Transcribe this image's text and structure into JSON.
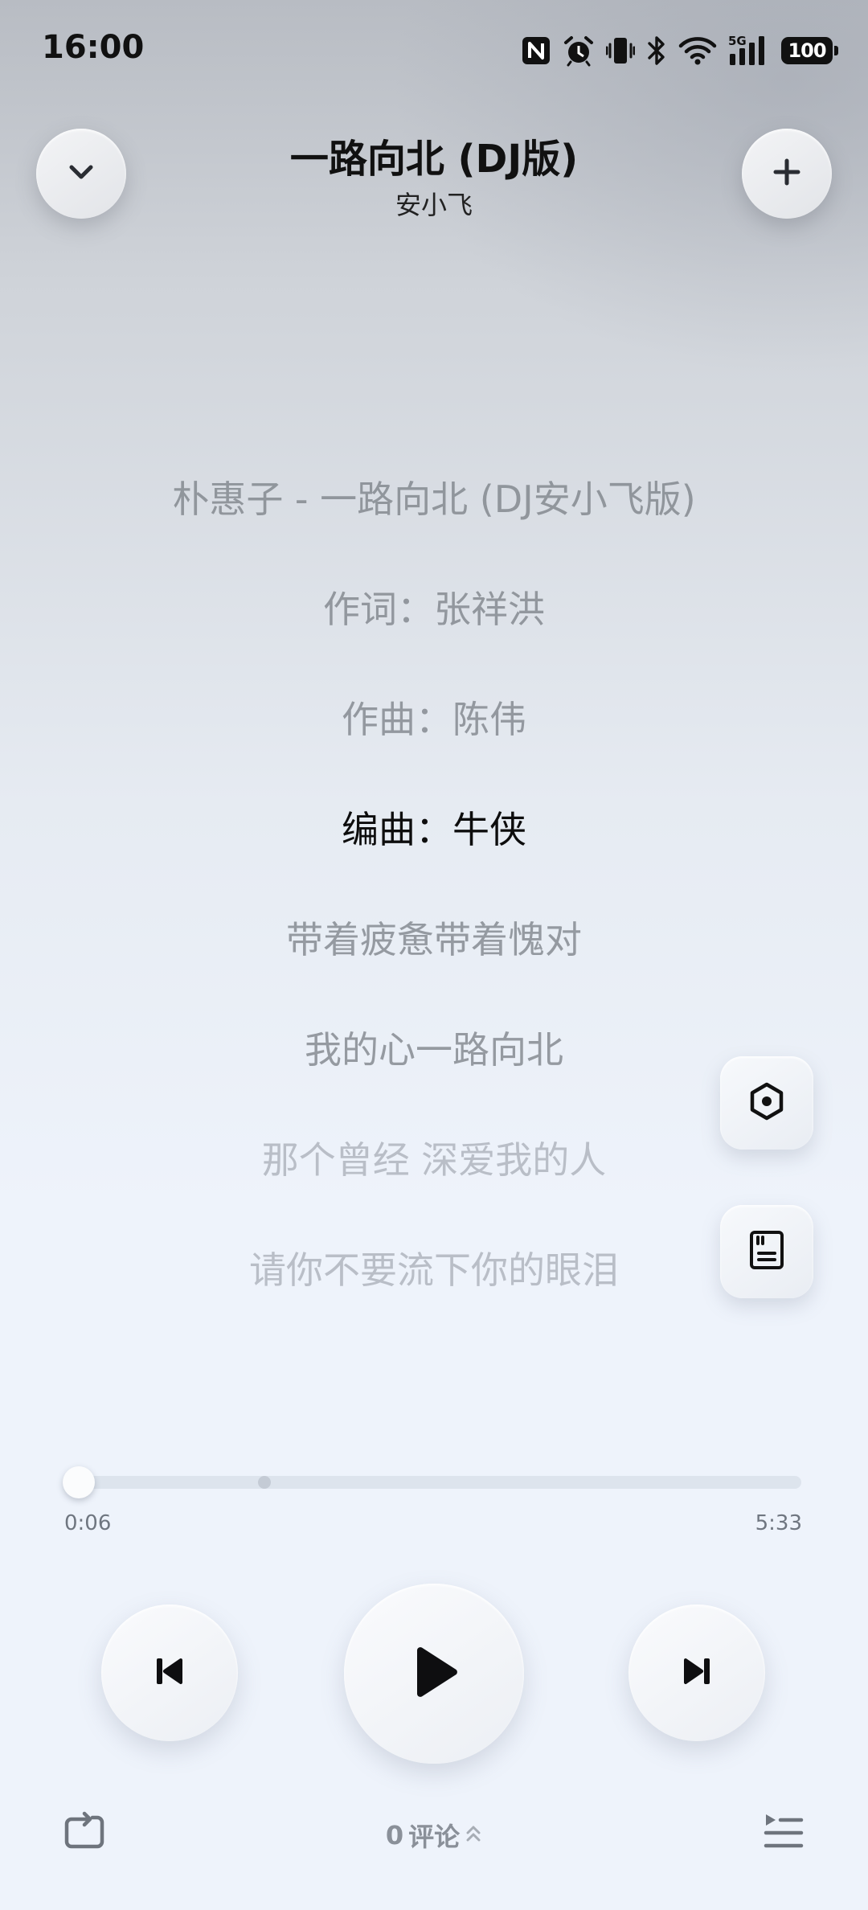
{
  "status_bar": {
    "time": "16:00",
    "icons": [
      "nfc-icon",
      "alarm-icon",
      "vibrate-icon",
      "bluetooth-icon",
      "wifi-icon",
      "signal-5g-icon"
    ],
    "network_label": "5G",
    "battery": "100"
  },
  "header": {
    "title": "一路向北 (DJ版)",
    "artist": "安小飞",
    "collapse_icon": "chevron-down-icon",
    "add_icon": "plus-icon"
  },
  "lyrics": {
    "lines": [
      "朴惠子 - 一路向北 (DJ安小飞版)",
      "作词：张祥洪",
      "作曲：陈伟",
      "编曲：牛侠",
      "带着疲惫带着愧对",
      "我的心一路向北",
      "那个曾经 深爱我的人",
      "请你不要流下你的眼泪"
    ],
    "active_index": 3
  },
  "side_actions": {
    "effect_icon": "hexagon-effect-icon",
    "lyrics_icon": "lyrics-sheet-icon"
  },
  "progress": {
    "current": "0:06",
    "total": "5:33",
    "played_fraction": 0.018,
    "buffer_marker_fraction": 0.27
  },
  "controls": {
    "prev_icon": "skip-previous-icon",
    "play_icon": "play-icon",
    "next_icon": "skip-next-icon"
  },
  "bottom_bar": {
    "repeat_icon": "repeat-icon",
    "comments_count": "0",
    "comments_label": "评论",
    "comments_icon": "chevron-up-double-icon",
    "queue_icon": "playlist-icon"
  },
  "colors": {
    "active_lyric": "#0d0d0d",
    "inactive_lyric": "#7d8289",
    "progress_track": "#dde4ed"
  }
}
